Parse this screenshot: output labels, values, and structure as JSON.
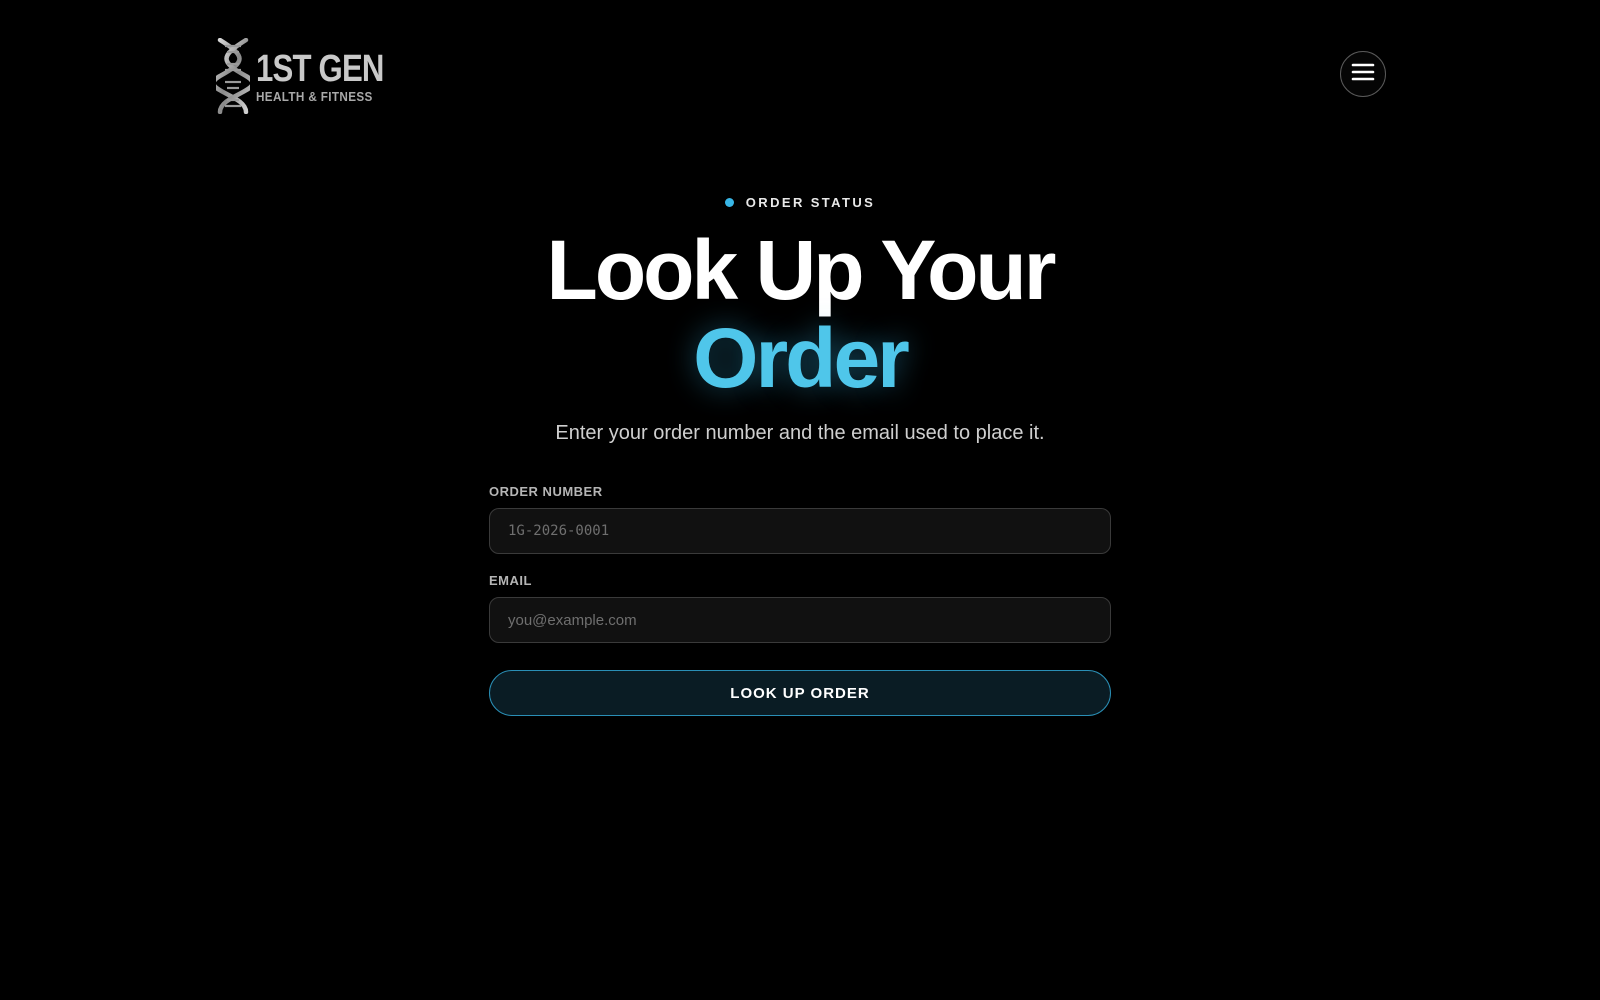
{
  "header": {
    "logo": {
      "title": "1ST GEN",
      "subtitle": "HEALTH & FITNESS",
      "icon": "dna-icon"
    },
    "menu_icon": "hamburger-menu-icon"
  },
  "hero": {
    "eyebrow": "ORDER STATUS",
    "headline_line1": "Look Up Your",
    "headline_line2": "Order",
    "subtitle": "Enter your order number and the email used to place it."
  },
  "form": {
    "order_number": {
      "label": "ORDER NUMBER",
      "value": "",
      "placeholder": "1G-2026-0001"
    },
    "email": {
      "label": "EMAIL",
      "value": "",
      "placeholder": "you@example.com"
    },
    "submit_label": "LOOK UP ORDER"
  },
  "colors": {
    "background": "#000000",
    "accent": "#4fc6ea",
    "accent_dot": "#38b6e6",
    "button_border": "#2a8fb6",
    "button_bg": "#0a1c24"
  }
}
